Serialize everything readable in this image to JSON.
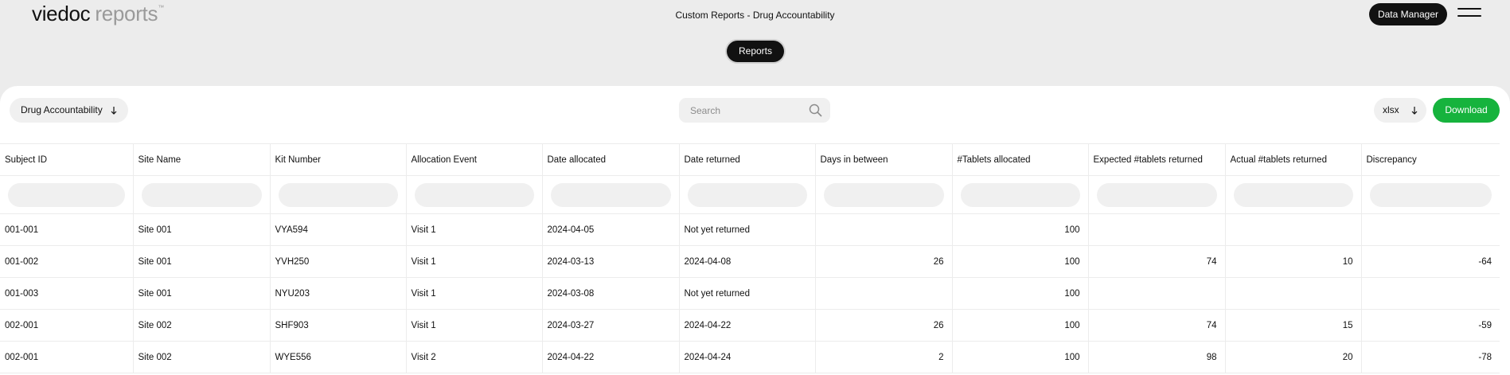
{
  "app": {
    "logo_primary": "viedoc",
    "logo_secondary": "reports",
    "logo_tm": "™",
    "page_title": "Custom Reports - Drug Accountability",
    "role_label": "Data Manager",
    "reports_pill": "Reports"
  },
  "toolbar": {
    "report_label": "Drug Accountability",
    "search_placeholder": "Search",
    "format_value": "xlsx",
    "download_label": "Download"
  },
  "table": {
    "columns": [
      "Subject ID",
      "Site Name",
      "Kit Number",
      "Allocation Event",
      "Date allocated",
      "Date returned",
      "Days in between",
      "#Tablets allocated",
      "Expected #tablets returned",
      "Actual #tablets returned",
      "Discrepancy"
    ],
    "rows": [
      [
        "001-001",
        "Site 001",
        "VYA594",
        "Visit 1",
        "2024-04-05",
        "Not yet returned",
        "",
        "100",
        "",
        "",
        ""
      ],
      [
        "001-002",
        "Site 001",
        "YVH250",
        "Visit 1",
        "2024-03-13",
        "2024-04-08",
        "26",
        "100",
        "74",
        "10",
        "-64"
      ],
      [
        "001-003",
        "Site 001",
        "NYU203",
        "Visit 1",
        "2024-03-08",
        "Not yet returned",
        "",
        "100",
        "",
        "",
        ""
      ],
      [
        "002-001",
        "Site 002",
        "SHF903",
        "Visit 1",
        "2024-03-27",
        "2024-04-22",
        "26",
        "100",
        "74",
        "15",
        "-59"
      ],
      [
        "002-001",
        "Site 002",
        "WYE556",
        "Visit 2",
        "2024-04-22",
        "2024-04-24",
        "2",
        "100",
        "98",
        "20",
        "-78"
      ]
    ]
  },
  "colors": {
    "background": "#ececec",
    "panel": "#ffffff",
    "accent_green": "#16b33d",
    "dark": "#111111"
  },
  "icons": {
    "search": "search-icon",
    "dropdown": "arrow-down-icon",
    "menu": "hamburger-menu-icon"
  }
}
